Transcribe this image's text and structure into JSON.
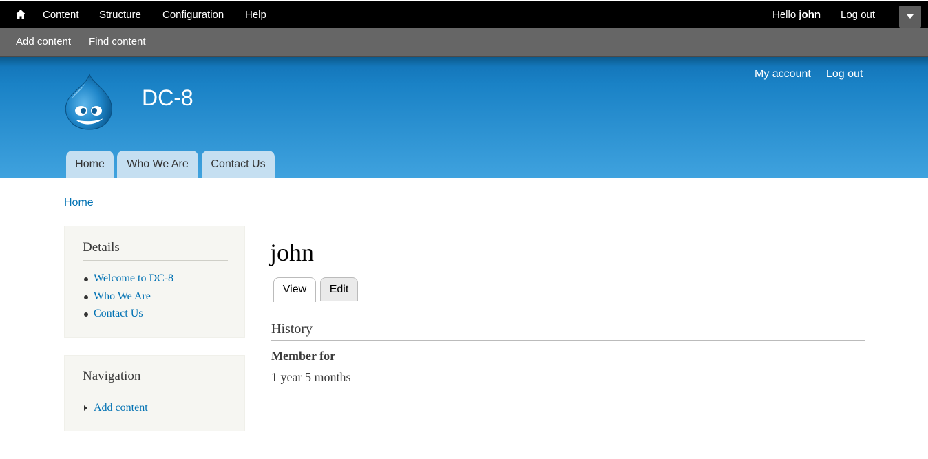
{
  "toolbar": {
    "home_icon": "home-icon",
    "items": [
      "Content",
      "Structure",
      "Configuration",
      "Help"
    ],
    "greeting": "Hello",
    "username": "john",
    "logout": "Log out",
    "toggle_icon": "caret-down-icon"
  },
  "shortcuts": {
    "items": [
      "Add content",
      "Find content"
    ]
  },
  "header": {
    "logo_icon": "drupal-drop-logo",
    "site_name": "DC-8",
    "secondary_menu": [
      "My account",
      "Log out"
    ],
    "main_menu": [
      "Home",
      "Who We Are",
      "Contact Us"
    ],
    "colors": {
      "header_top": "#0b5a8c",
      "header_bottom": "#3fa2de",
      "tab_bg": "#c5dff1"
    }
  },
  "breadcrumb": {
    "home": "Home"
  },
  "sidebar": {
    "details": {
      "title": "Details",
      "links": [
        "Welcome to DC-8",
        "Who We Are",
        "Contact Us"
      ]
    },
    "navigation": {
      "title": "Navigation",
      "links": [
        "Add content"
      ]
    }
  },
  "main": {
    "title": "john",
    "tabs": [
      "View",
      "Edit"
    ],
    "section_title": "History",
    "field_label": "Member for",
    "field_value": "1 year 5 months"
  },
  "colors": {
    "link": "#0071b3",
    "toolbar": "#000000",
    "tray": "#666666"
  }
}
